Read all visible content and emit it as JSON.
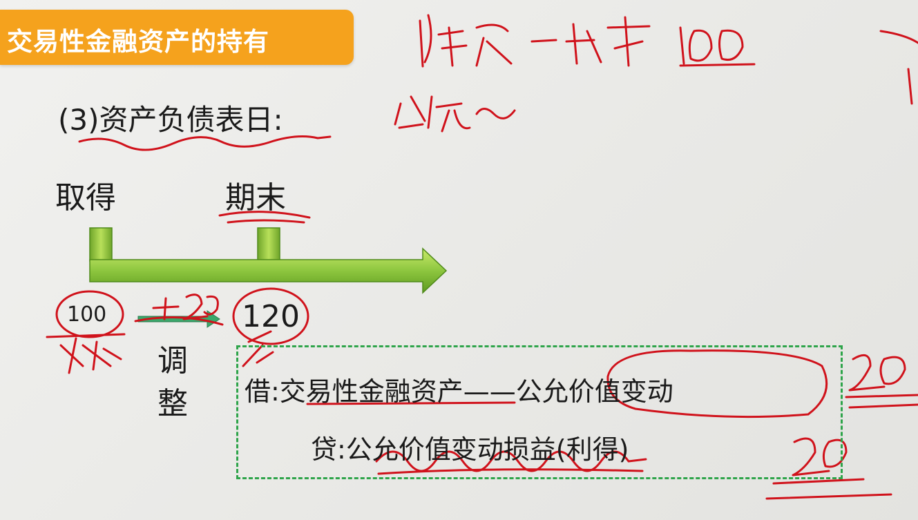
{
  "title": "交易性金融资产的持有",
  "section_heading": "(3)资产负债表日:",
  "timeline": {
    "start_label": "取得",
    "end_label": "期末",
    "start_value": "100",
    "end_value": "120",
    "adjust_label_1": "调",
    "adjust_label_2": "整"
  },
  "journal_entry": {
    "debit": "借:交易性金融资产——公允价值变动",
    "credit": "贷:公允价值变动损益(利得)"
  },
  "colors": {
    "banner": "#f5a21d",
    "timeline_green": "#8dc63f",
    "dashed_box": "#2ea44a",
    "annotation_red": "#d0121b"
  }
}
